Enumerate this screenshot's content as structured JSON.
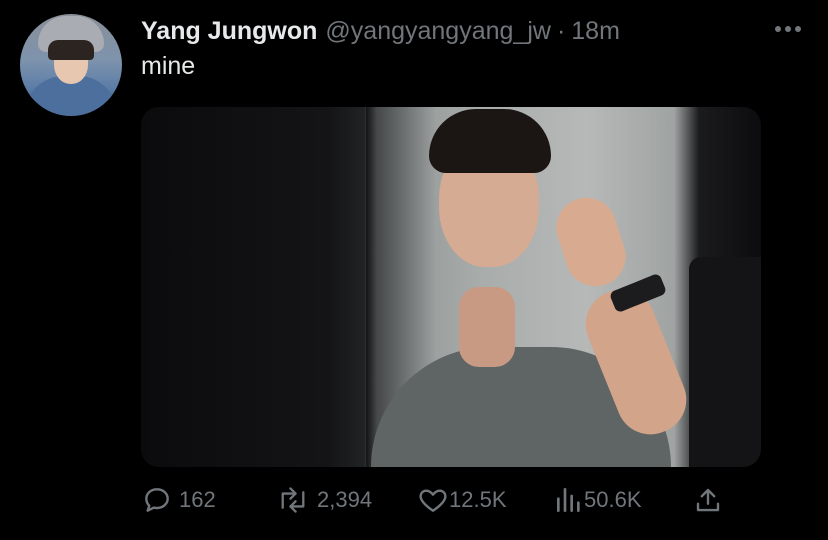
{
  "tweet": {
    "author": {
      "display_name": "Yang Jungwon",
      "handle": "@yangyangyang_jw"
    },
    "separator": "·",
    "time": "18m",
    "text": "mine",
    "metrics": {
      "replies": "162",
      "retweets": "2,394",
      "likes": "12.5K",
      "views": "50.6K"
    }
  },
  "icons": {
    "more": "more-horizontal-icon",
    "reply": "reply-icon",
    "retweet": "retweet-icon",
    "like": "heart-icon",
    "views": "views-icon",
    "share": "share-icon"
  },
  "colors": {
    "background": "#000000",
    "primary_text": "#e7e9ea",
    "secondary_text": "#71767b"
  }
}
